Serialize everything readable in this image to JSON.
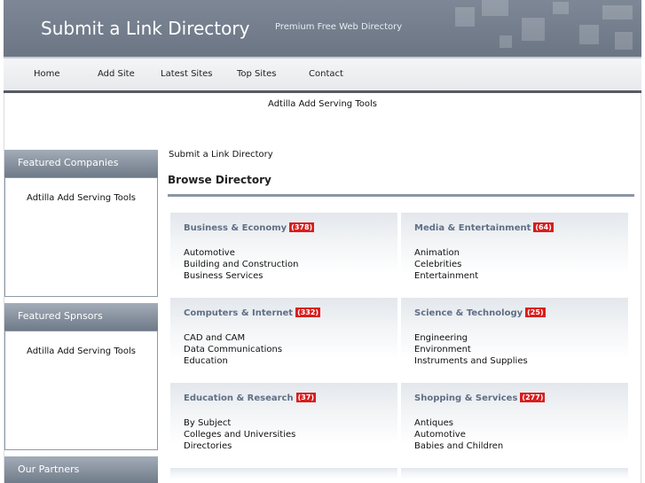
{
  "header": {
    "title": "Submit a Link Directory",
    "slogan": "Premium Free Web Directory"
  },
  "nav": {
    "items": [
      {
        "label": "Home"
      },
      {
        "label": "Add Site"
      },
      {
        "label": "Latest Sites"
      },
      {
        "label": "Top Sites"
      },
      {
        "label": "Contact"
      }
    ]
  },
  "banner": {
    "text": "Adtilla Add Serving Tools"
  },
  "sidebar": {
    "featured_companies": {
      "title": "Featured Companies",
      "link": "Adtilla Add Serving Tools"
    },
    "featured_sponsors": {
      "title": "Featured Spnsors",
      "link": "Adtilla Add Serving Tools"
    },
    "partners": {
      "title": "Our Partners"
    }
  },
  "main": {
    "breadcrumb": "Submit a Link Directory",
    "title": "Browse Directory",
    "categories": [
      {
        "name": "Business & Economy",
        "count": "(378)",
        "subs": [
          "Automotive",
          "Building and Construction",
          "Business Services"
        ]
      },
      {
        "name": "Media & Entertainment",
        "count": "(64)",
        "subs": [
          "Animation",
          "Celebrities",
          "Entertainment"
        ]
      },
      {
        "name": "Computers & Internet",
        "count": "(332)",
        "subs": [
          "CAD and CAM",
          "Data Communications",
          "Education"
        ]
      },
      {
        "name": "Science & Technology",
        "count": "(25)",
        "subs": [
          "Engineering",
          "Environment",
          "Instruments and Supplies"
        ]
      },
      {
        "name": "Education & Research",
        "count": "(37)",
        "subs": [
          "By Subject",
          "Colleges and Universities",
          "Directories"
        ]
      },
      {
        "name": "Shopping & Services",
        "count": "(277)",
        "subs": [
          "Antiques",
          "Automotive",
          "Babies and Children"
        ]
      }
    ]
  },
  "colors": {
    "header_bg": "#7d8796",
    "nav_underline": "#555b63",
    "category_title": "#5f6f86",
    "count_badge": "#d81e1e",
    "sidebar_head": "#6f7a88"
  }
}
